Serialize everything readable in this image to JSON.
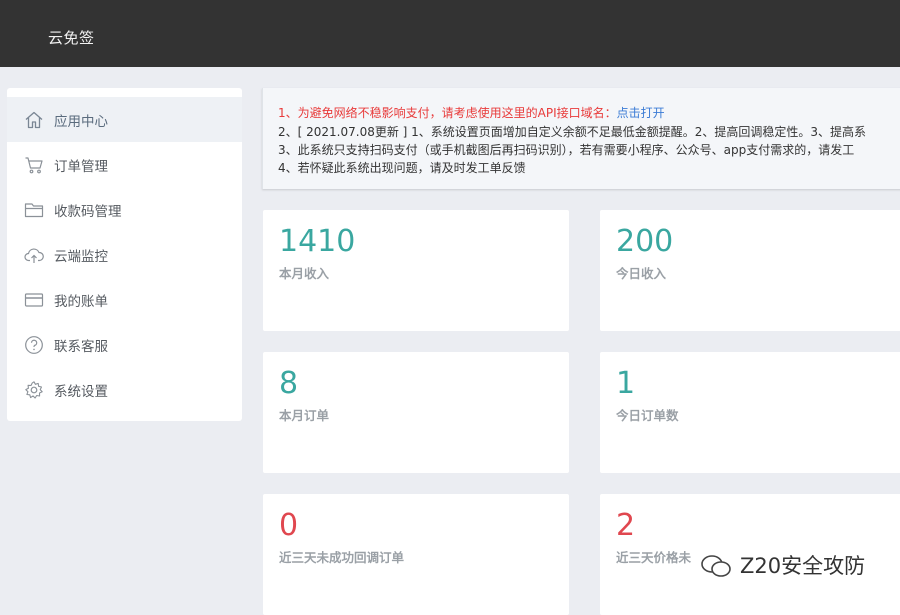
{
  "app": {
    "title": "云免签"
  },
  "sidebar": {
    "items": [
      {
        "label": "应用中心",
        "icon": "home-icon",
        "active": true
      },
      {
        "label": "订单管理",
        "icon": "cart-icon",
        "active": false
      },
      {
        "label": "收款码管理",
        "icon": "folder-icon",
        "active": false
      },
      {
        "label": "云端监控",
        "icon": "cloud-upload-icon",
        "active": false
      },
      {
        "label": "我的账单",
        "icon": "card-icon",
        "active": false
      },
      {
        "label": "联系客服",
        "icon": "help-icon",
        "active": false
      },
      {
        "label": "系统设置",
        "icon": "gear-icon",
        "active": false
      }
    ]
  },
  "notice": {
    "line1_text": "1、为避免网络不稳影响支付，请考虑使用这里的API接口域名：",
    "line1_link": "点击打开",
    "line2": "2、[ 2021.07.08更新 ] 1、系统设置页面增加自定义余额不足最低金额提醒。2、提高回调稳定性。3、提高系",
    "line3": "3、此系统只支持扫码支付（或手机截图后再扫码识别），若有需要小程序、公众号、app支付需求的，请发工",
    "line4": "4、若怀疑此系统出现问题，请及时发工单反馈"
  },
  "stats": [
    {
      "value": "1410",
      "label": "本月收入"
    },
    {
      "value": "200",
      "label": "今日收入"
    },
    {
      "value": "8",
      "label": "本月订单"
    },
    {
      "value": "1",
      "label": "今日订单数"
    },
    {
      "value": "0",
      "label": "近三天未成功回调订单"
    },
    {
      "value": "2",
      "label": "近三天价格未"
    }
  ],
  "watermark": {
    "text": "Z20安全攻防"
  },
  "colors": {
    "topbar": "#333333",
    "accent_teal": "#3aa7a0",
    "alert_red": "#e0474f",
    "notice_red": "#e83a3a",
    "link_blue": "#3a7bd5"
  }
}
